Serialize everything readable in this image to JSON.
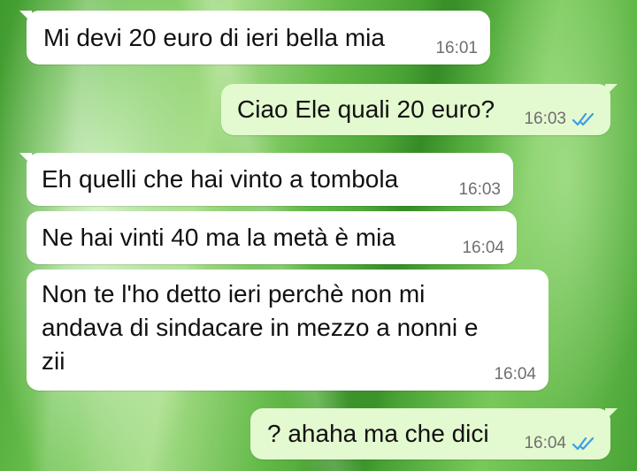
{
  "messages": [
    {
      "direction": "incoming",
      "text": "Mi devi 20 euro di ieri bella mia",
      "time": "16:01"
    },
    {
      "direction": "outgoing",
      "text": "Ciao Ele quali 20 euro?",
      "time": "16:03",
      "status": "read"
    },
    {
      "direction": "incoming",
      "text": "Eh quelli che hai vinto a tombola",
      "time": "16:03"
    },
    {
      "direction": "incoming",
      "text": "Ne hai vinti 40 ma la metà è mia",
      "time": "16:04"
    },
    {
      "direction": "incoming",
      "text": "Non te l'ho detto ieri perchè non mi\nandava di sindacare in mezzo a nonni e\nzii",
      "time": "16:04"
    },
    {
      "direction": "outgoing",
      "text": "? ahaha ma che dici",
      "time": "16:04",
      "status": "read"
    }
  ],
  "colors": {
    "incoming_bubble": "#ffffff",
    "outgoing_bubble": "#e3f9cf",
    "read_check": "#3a9ee8",
    "timestamp": "#6f6f6f"
  }
}
